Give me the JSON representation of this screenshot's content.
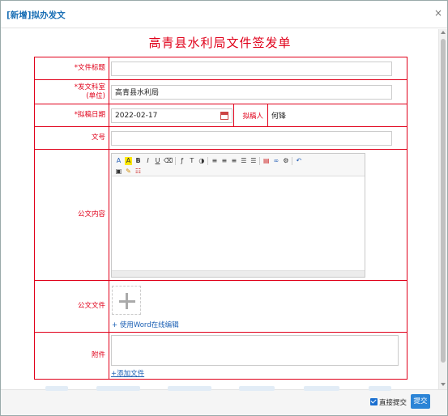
{
  "dialog": {
    "title": "[新增]拟办发文",
    "close_glyph": "×"
  },
  "doc_title": "高青县水利局文件签发单",
  "fields": {
    "subject": {
      "label": "文件标题",
      "value": ""
    },
    "dept": {
      "label_line1": "发文科室",
      "label_line2": "(单位)",
      "value": "高青县水利局"
    },
    "date": {
      "label": "拟稿日期",
      "value": "2022-02-17"
    },
    "author": {
      "label": "拟稿人",
      "value": "何锋"
    },
    "doc_number": {
      "label": "文号",
      "value": ""
    },
    "content": {
      "label": "公文内容"
    },
    "doc_file": {
      "label": "公文文件",
      "link": "+ 使用Word在线编辑"
    },
    "attachment": {
      "label": "附件",
      "link": "+添加文件"
    }
  },
  "required_mark": "*",
  "toolbar": {
    "row1": [
      "A",
      "A",
      "B",
      "I",
      "U",
      "⌫",
      "ƒ",
      "T",
      "◑",
      "≡",
      "≡",
      "≡",
      "☰",
      "☰",
      "▤",
      "∞",
      "⚙",
      "↶"
    ],
    "row2": [
      "▣",
      "✎",
      "☷"
    ]
  },
  "footer": {
    "direct_submit_label": "直接提交",
    "direct_submit_checked": true,
    "submit_label": "提交"
  },
  "colors": {
    "accent": "#e0001a",
    "title_blue": "#1a6fb5",
    "submit_blue": "#2b84d6"
  }
}
